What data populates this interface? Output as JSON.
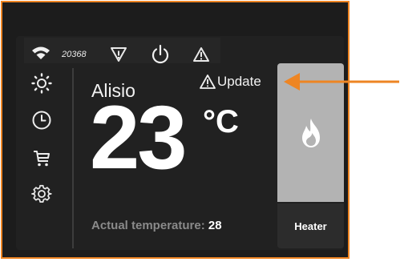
{
  "status": {
    "wifi_icon": "wifi-icon",
    "device_id": "20368",
    "icons": [
      "filter-warning-icon",
      "power-icon",
      "warning-icon"
    ]
  },
  "sidebar": {
    "items": [
      {
        "icon": "sun-icon"
      },
      {
        "icon": "clock-icon"
      },
      {
        "icon": "cart-icon"
      },
      {
        "icon": "gear-icon"
      }
    ]
  },
  "main": {
    "zone_name": "Alisio",
    "update_label": "Update",
    "set_temperature": "23",
    "unit": "°C",
    "actual_label": "Actual temperature:",
    "actual_value": "28"
  },
  "mode": {
    "icon": "flame-icon",
    "label": "Heater"
  },
  "colors": {
    "accent": "#ee8523",
    "background": "#1c1c1c",
    "mode_button": "#b3b3b3"
  }
}
